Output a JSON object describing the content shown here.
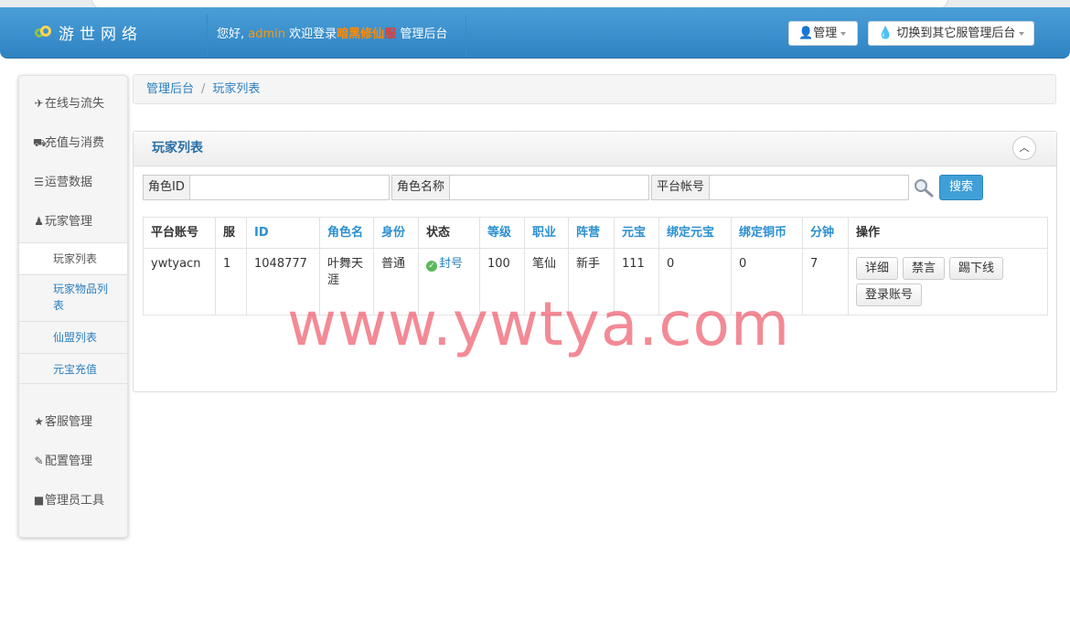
{
  "header": {
    "logo_text": "游世网络",
    "welcome_prefix": "您好,",
    "username": "admin",
    "welcome_mid": "欢迎登录",
    "server_name": "暗黑修仙",
    "server_tag": "服",
    "welcome_suffix": "管理后台",
    "manage_label": "管理",
    "switch_label": "切换到其它服管理后台"
  },
  "sidebar": {
    "items": [
      {
        "icon": "plane-icon",
        "glyph": "✈",
        "label": "在线与流失"
      },
      {
        "icon": "cart-icon",
        "glyph": "🛒",
        "label": "充值与消费"
      },
      {
        "icon": "list-icon",
        "glyph": "☰",
        "label": "运营数据"
      },
      {
        "icon": "user-icon",
        "glyph": "👤",
        "label": "玩家管理"
      },
      {
        "icon": "star-icon",
        "glyph": "★",
        "label": "客服管理"
      },
      {
        "icon": "edit-icon",
        "glyph": "✎",
        "label": "配置管理"
      },
      {
        "icon": "lock-icon",
        "glyph": "🔒",
        "label": "管理员工具"
      }
    ],
    "sub_items": [
      "玩家列表",
      "玩家物品列表",
      "仙盟列表",
      "元宝充值"
    ]
  },
  "breadcrumb": {
    "root": "管理后台",
    "sep": "/",
    "current": "玩家列表"
  },
  "panel": {
    "title": "玩家列表"
  },
  "search": {
    "role_id_label": "角色ID",
    "role_name_label": "角色名称",
    "platform_account_label": "平台帐号",
    "button_label": "搜索"
  },
  "table": {
    "headers": [
      "平台账号",
      "服",
      "ID",
      "角色名",
      "身份",
      "状态",
      "等级",
      "职业",
      "阵营",
      "元宝",
      "绑定元宝",
      "绑定铜币",
      "分钟",
      "操作"
    ],
    "rows": [
      {
        "platform_account": "ywtyacn",
        "server": "1",
        "id": "1048777",
        "role_name": "叶舞天涯",
        "identity": "普通",
        "status": "封号",
        "level": "100",
        "job": "笔仙",
        "faction": "新手",
        "yuanbao": "111",
        "bound_yuanbao": "0",
        "bound_copper": "0",
        "minutes": "7",
        "actions": [
          "详细",
          "禁言",
          "踢下线",
          "登录账号"
        ]
      }
    ]
  },
  "watermark": "www.ywtya.com",
  "colors": {
    "header": "#3a91cf",
    "link": "#2a7fbe",
    "search_button": "#3f9fd6"
  }
}
